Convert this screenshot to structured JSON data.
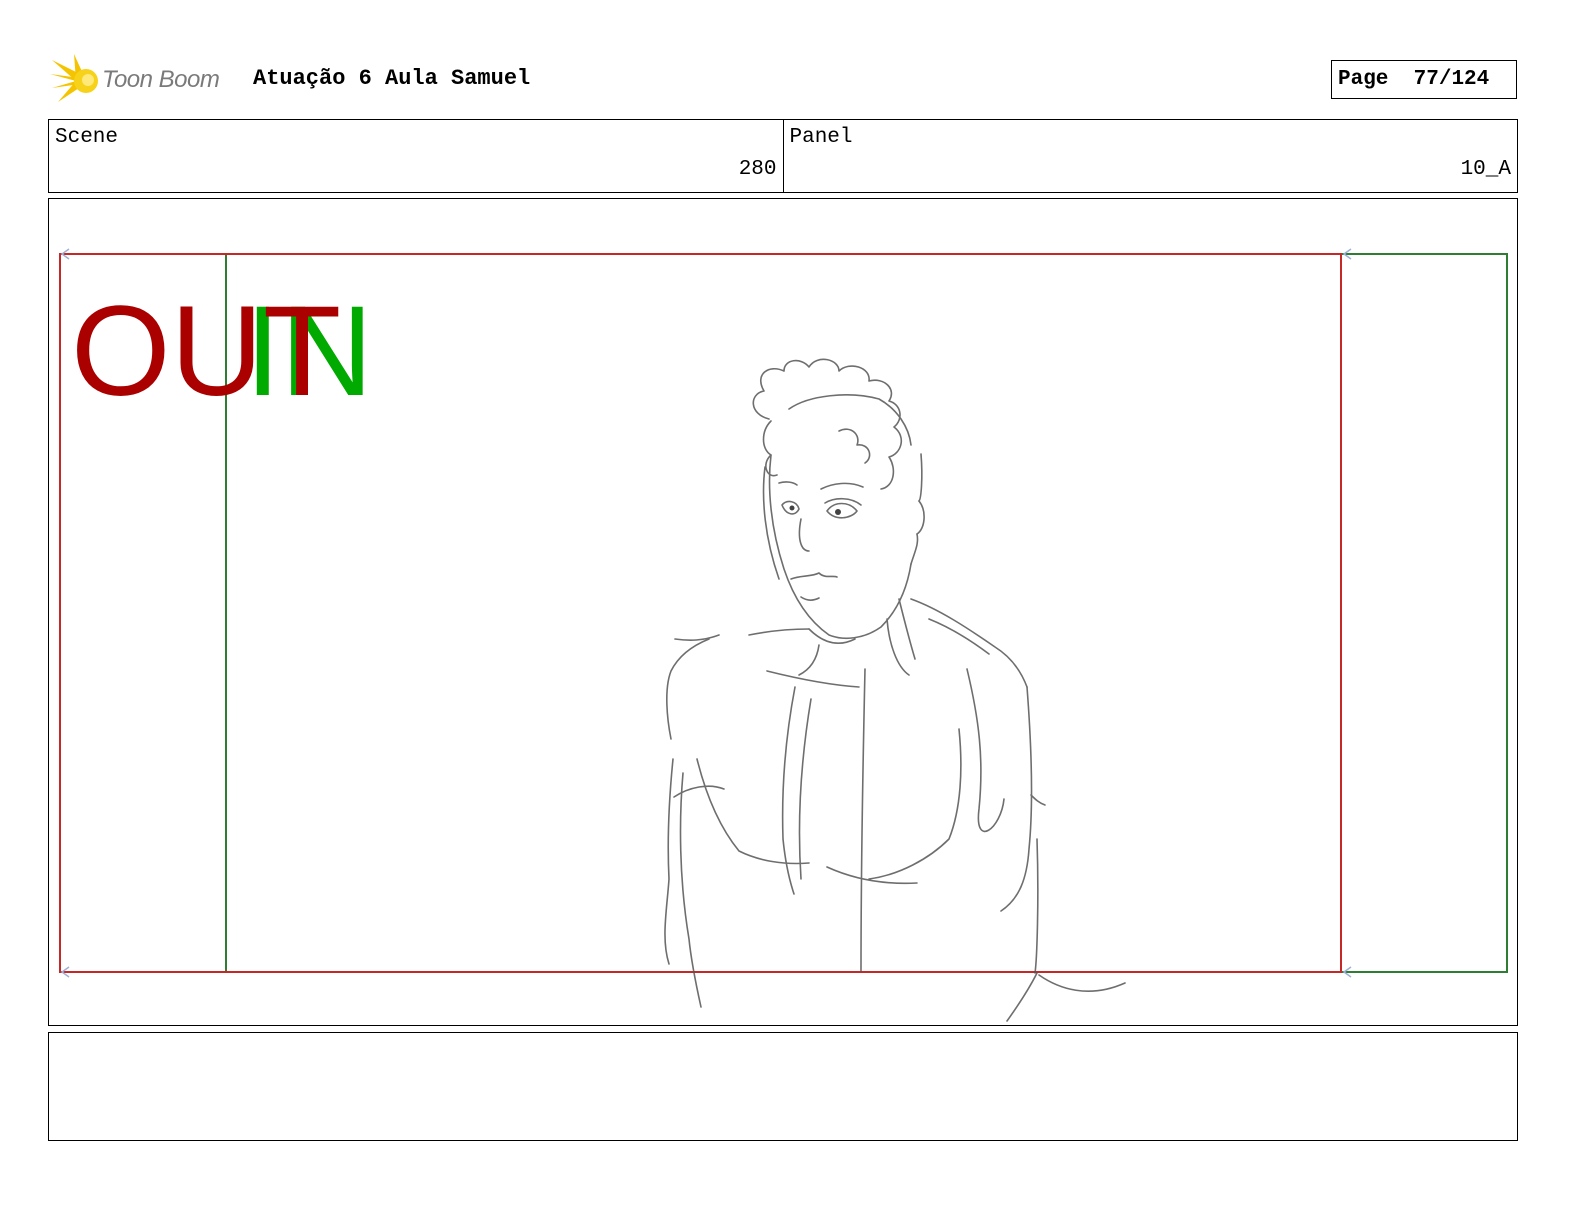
{
  "header": {
    "logo_text": "Toon Boom",
    "project_title": "Atuação 6 Aula Samuel",
    "page_label": "Page",
    "page_number": "77/124"
  },
  "info": {
    "scene_label": "Scene",
    "scene_value": "280",
    "panel_label": "Panel",
    "panel_value": "10_A"
  },
  "frame": {
    "in_label": "IN",
    "out_label": "OUT",
    "in_color": "#00aa00",
    "out_color": "#aa0000",
    "in_frame_color": "#2e7d32",
    "out_frame_color": "#c62828"
  },
  "notes": {
    "text": ""
  }
}
